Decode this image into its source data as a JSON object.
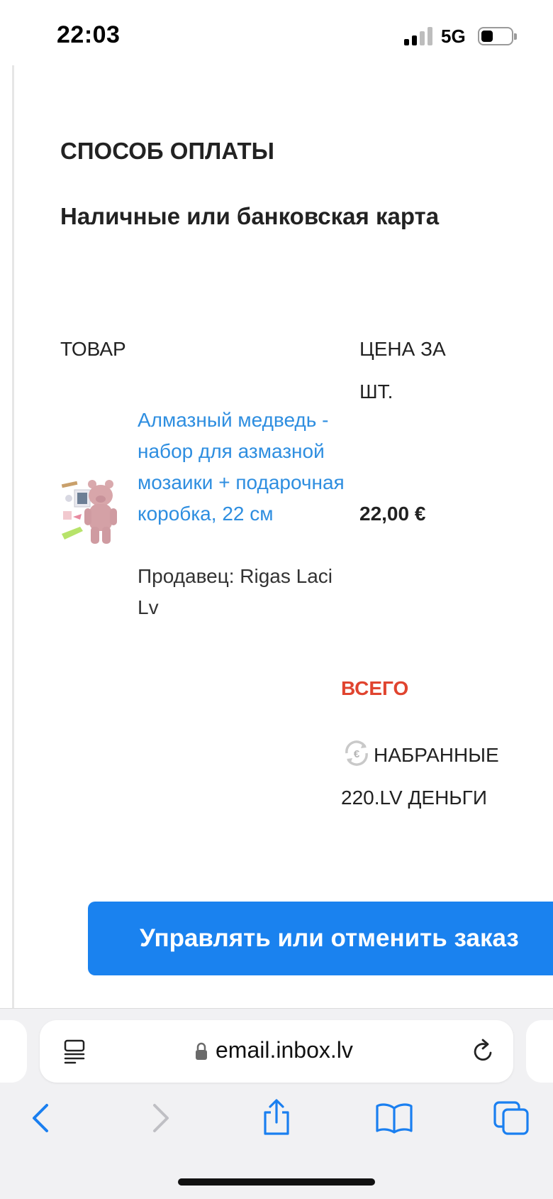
{
  "status_bar": {
    "time": "22:03",
    "network": "5G"
  },
  "email": {
    "payment_heading": "СПОСОБ ОПЛАТЫ",
    "payment_method": "Наличные или банковская карта",
    "table": {
      "col_product": "ТОВАР",
      "col_price": "ЦЕНА ЗА ШТ."
    },
    "item": {
      "name": "Алмазный медведь - набор для азмазной мозаики + подарочная коробка, 22 см",
      "seller": "Продавец: Rigas Laci Lv",
      "price": "22,00 €"
    },
    "total_label": "ВСЕГО",
    "collected_label": "НАБРАННЫЕ 220.LV ДЕНЬГИ",
    "cta_label": "Управлять или отменить заказ"
  },
  "browser": {
    "url": "email.inbox.lv",
    "icons": [
      "reader-icon",
      "lock-icon",
      "reload-icon",
      "back-icon",
      "forward-icon",
      "share-icon",
      "bookmarks-icon",
      "tabs-icon"
    ]
  },
  "colors": {
    "link": "#2e8ee0",
    "accent_button": "#1a82ef",
    "total_red": "#e0442f",
    "toolbar_blue": "#1a7ff0"
  }
}
